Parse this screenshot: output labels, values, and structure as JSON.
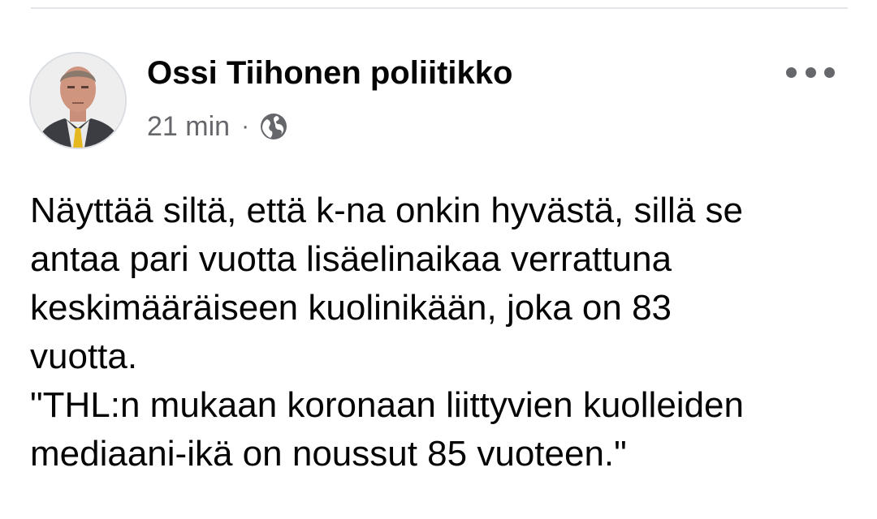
{
  "post": {
    "author": "Ossi Tiihonen poliitikko",
    "time": "21 min",
    "separator": "·",
    "audience_icon": "globe-icon",
    "more_icon": "more-options-icon",
    "text_lines": [
      "Näyttää siltä, että k-na onkin hyvästä, sillä se",
      "antaa pari vuotta lisäelinaikaa verrattuna",
      "keskimääräiseen kuolinikään, joka on 83",
      "vuotta.",
      "\"THL:n mukaan koronaan liittyvien kuolleiden",
      "mediaani-ikä on noussut 85 vuoteen.\""
    ]
  },
  "colors": {
    "text_primary": "#050505",
    "text_secondary": "#65676b",
    "divider": "#e3e5e8",
    "background": "#ffffff"
  }
}
